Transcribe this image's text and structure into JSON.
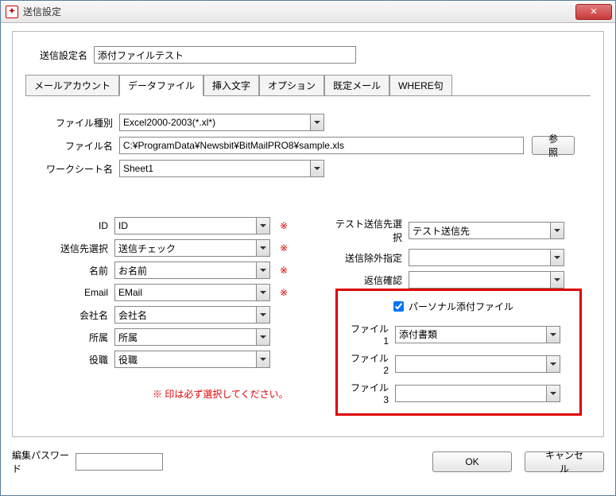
{
  "window": {
    "title": "送信設定"
  },
  "settingName": {
    "label": "送信設定名",
    "value": "添付ファイルテスト"
  },
  "tabs": {
    "mailAccount": "メールアカウント",
    "dataFile": "データファイル",
    "insertText": "挿入文字",
    "option": "オプション",
    "defaultMail": "既定メール",
    "whereClause": "WHERE句"
  },
  "fileType": {
    "label": "ファイル種別",
    "value": "Excel2000-2003(*.xl*)"
  },
  "fileName": {
    "label": "ファイル名",
    "value": "C:¥ProgramData¥Newsbit¥BitMailPRO8¥sample.xls"
  },
  "browse": "参照",
  "worksheet": {
    "label": "ワークシート名",
    "value": "Sheet1"
  },
  "left": {
    "id": {
      "label": "ID",
      "value": "ID"
    },
    "sendSel": {
      "label": "送信先選択",
      "value": "送信チェック"
    },
    "name": {
      "label": "名前",
      "value": "お名前"
    },
    "email": {
      "label": "Email",
      "value": "EMail"
    },
    "company": {
      "label": "会社名",
      "value": "会社名"
    },
    "affiliation": {
      "label": "所属",
      "value": "所属"
    },
    "title": {
      "label": "役職",
      "value": "役職"
    }
  },
  "right": {
    "testDest": {
      "label": "テスト送信先選択",
      "value": "テスト送信先"
    },
    "exclude": {
      "label": "送信除外指定",
      "value": ""
    },
    "replyConfirm": {
      "label": "返信確認",
      "value": ""
    }
  },
  "personal": {
    "checkbox": "パーソナル添付ファイル",
    "file1": {
      "label": "ファイル1",
      "value": "添付書類"
    },
    "file2": {
      "label": "ファイル2",
      "value": ""
    },
    "file3": {
      "label": "ファイル3",
      "value": ""
    }
  },
  "reqMark": "※",
  "note": "※ 印は必ず選択してください。",
  "editPassword": {
    "label": "編集パスワード",
    "value": ""
  },
  "ok": "OK",
  "cancel": "キャンセル"
}
